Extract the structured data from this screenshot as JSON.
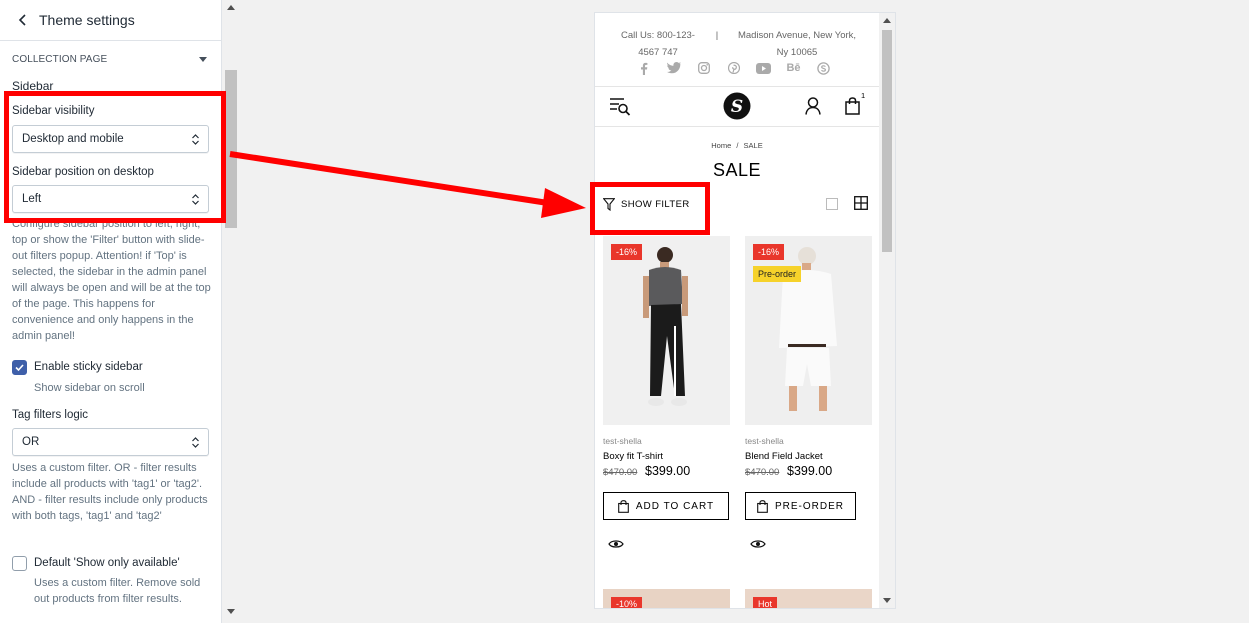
{
  "panel": {
    "title": "Theme settings",
    "section": "COLLECTION PAGE",
    "subsection": "Sidebar",
    "sidebar_visibility": {
      "label": "Sidebar visibility",
      "value": "Desktop and mobile"
    },
    "sidebar_position": {
      "label": "Sidebar position on desktop",
      "value": "Left"
    },
    "position_help": "Configure sidebar position to left, right, top or show the 'Filter' button with slide-out filters popup. Attention! if 'Top' is selected, the sidebar in the admin panel will always be open and will be at the top of the page. This happens for convenience and only happens in the admin panel!",
    "sticky": {
      "label": "Enable sticky sidebar",
      "help": "Show sidebar on scroll",
      "checked": true
    },
    "tag_logic": {
      "label": "Tag filters logic",
      "value": "OR",
      "help": "Uses a custom filter. OR - filter results include all products with 'tag1' or 'tag2'. AND - filter results include only products with both tags, 'tag1' and 'tag2'"
    },
    "show_available": {
      "label": "Default 'Show only available'",
      "help": "Uses a custom filter. Remove sold out products from filter results.",
      "checked": false
    }
  },
  "store": {
    "call_line1": "Call Us: 800-123-",
    "call_line2": "4567 747",
    "separator": "|",
    "address_line1": "Madison Avenue, New York,",
    "address_line2": "Ny 10065",
    "socials": [
      "facebook-icon",
      "twitter-icon",
      "instagram-icon",
      "pinterest-icon",
      "youtube-icon",
      "behance-icon",
      "skype-icon"
    ],
    "behance_text": "Bē",
    "cart_count": "1",
    "logo_letter": "S",
    "breadcrumb_home": "Home",
    "breadcrumb_sep": "/",
    "breadcrumb_current": "SALE",
    "page_title": "SALE",
    "show_filter": "SHOW FILTER",
    "products": [
      {
        "badge": "-16%",
        "vendor": "test-shella",
        "name": "Boxy fit T-shirt",
        "old_price": "$470.00",
        "price": "$399.00",
        "button": "ADD TO CART"
      },
      {
        "badge": "-16%",
        "badge2": "Pre-order",
        "vendor": "test-shella",
        "name": "Blend Field Jacket",
        "old_price": "$470.00",
        "price": "$399.00",
        "button": "PRE-ORDER"
      }
    ],
    "next_badges": [
      "-10%",
      "Hot"
    ]
  },
  "colors": {
    "accent_red": "#f00",
    "badge_red": "#e9362b",
    "preorder_yellow": "#f6d22a",
    "checkbox_blue": "#3e5fa9"
  }
}
